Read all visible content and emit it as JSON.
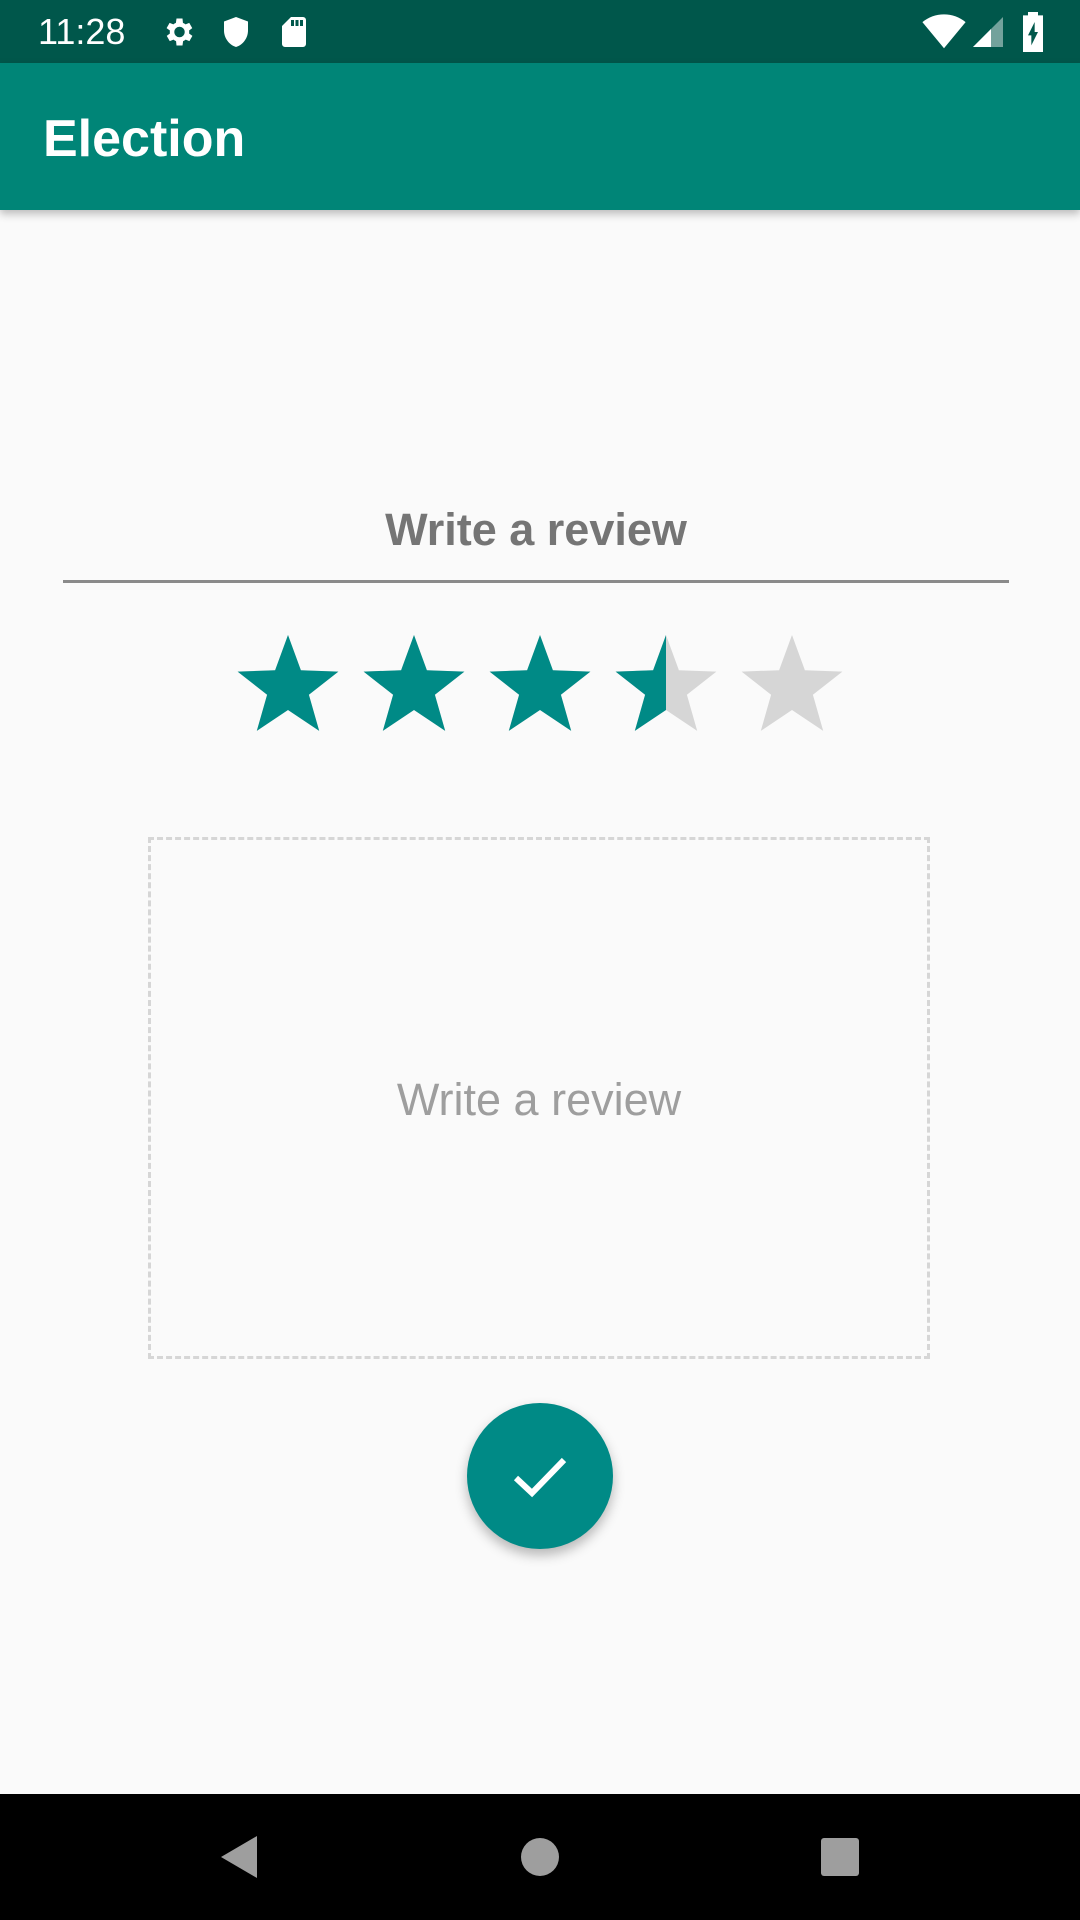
{
  "status_bar": {
    "time": "11:28",
    "icons": [
      "settings-gear-icon",
      "shield-icon",
      "sd-card-icon",
      "wifi-icon",
      "cell-signal-icon",
      "battery-charging-icon"
    ]
  },
  "app_bar": {
    "title": "Election"
  },
  "review": {
    "heading": "Write a review",
    "rating": 3.5,
    "max_rating": 5,
    "input_placeholder": "Write a review"
  },
  "fab": {
    "icon": "check-icon"
  },
  "nav_bar": {
    "icons": [
      "back-icon",
      "home-icon",
      "recents-icon"
    ]
  },
  "colors": {
    "status_bar": "#00574b",
    "app_bar": "#008577",
    "accent": "#008a86",
    "star_empty": "#d6d6d6",
    "background": "#fafafa"
  }
}
